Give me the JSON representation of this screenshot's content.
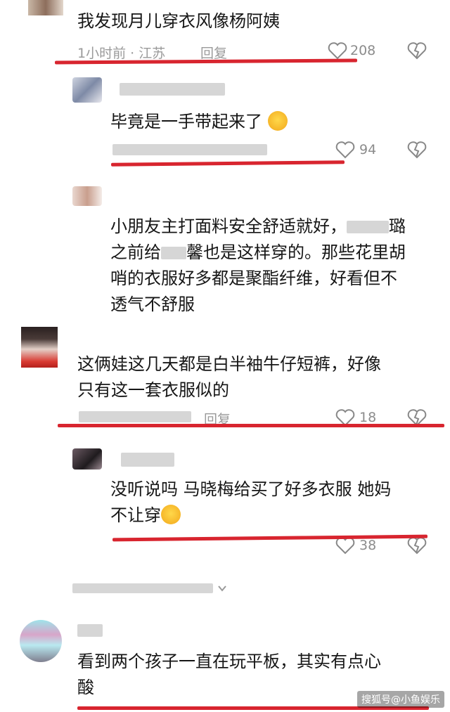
{
  "comments": [
    {
      "text": "我发现月儿穿衣风像杨阿姨",
      "meta": "1小时前 · 江苏",
      "reply": "回复",
      "likes": "208"
    },
    {
      "text": "毕竟是一手带起来了",
      "likes": "94"
    },
    {
      "text_lines": [
        "小朋友主打面料安全舒适就好，",
        "之前给",
        "也是这样穿的。那些花里胡",
        "哨的衣服好多都是聚酯纤维，好看但不",
        "透气不舒服"
      ],
      "suffix1": "璐",
      "suffix2": "馨"
    },
    {
      "text_lines": [
        "这俩娃这几天都是白半袖牛仔短裤，好像",
        "只有这一套衣服似的"
      ],
      "reply": "回复",
      "likes": "18"
    },
    {
      "text_lines": [
        "没听说吗 马晓梅给买了好多衣服 她妈",
        "不让穿"
      ],
      "likes": "38"
    },
    {
      "text_lines": [
        "看到两个孩子一直在玩平板，其实有点心",
        "酸"
      ]
    }
  ],
  "watermark": "搜狐号@小鱼娱乐",
  "colors": {
    "underline": "#d8252f",
    "meta": "#9a9a9a"
  },
  "icons": [
    "heart-icon",
    "dislike-icon",
    "expand-chevron-icon",
    "cry-laugh-emoji",
    "sad-emoji"
  ]
}
